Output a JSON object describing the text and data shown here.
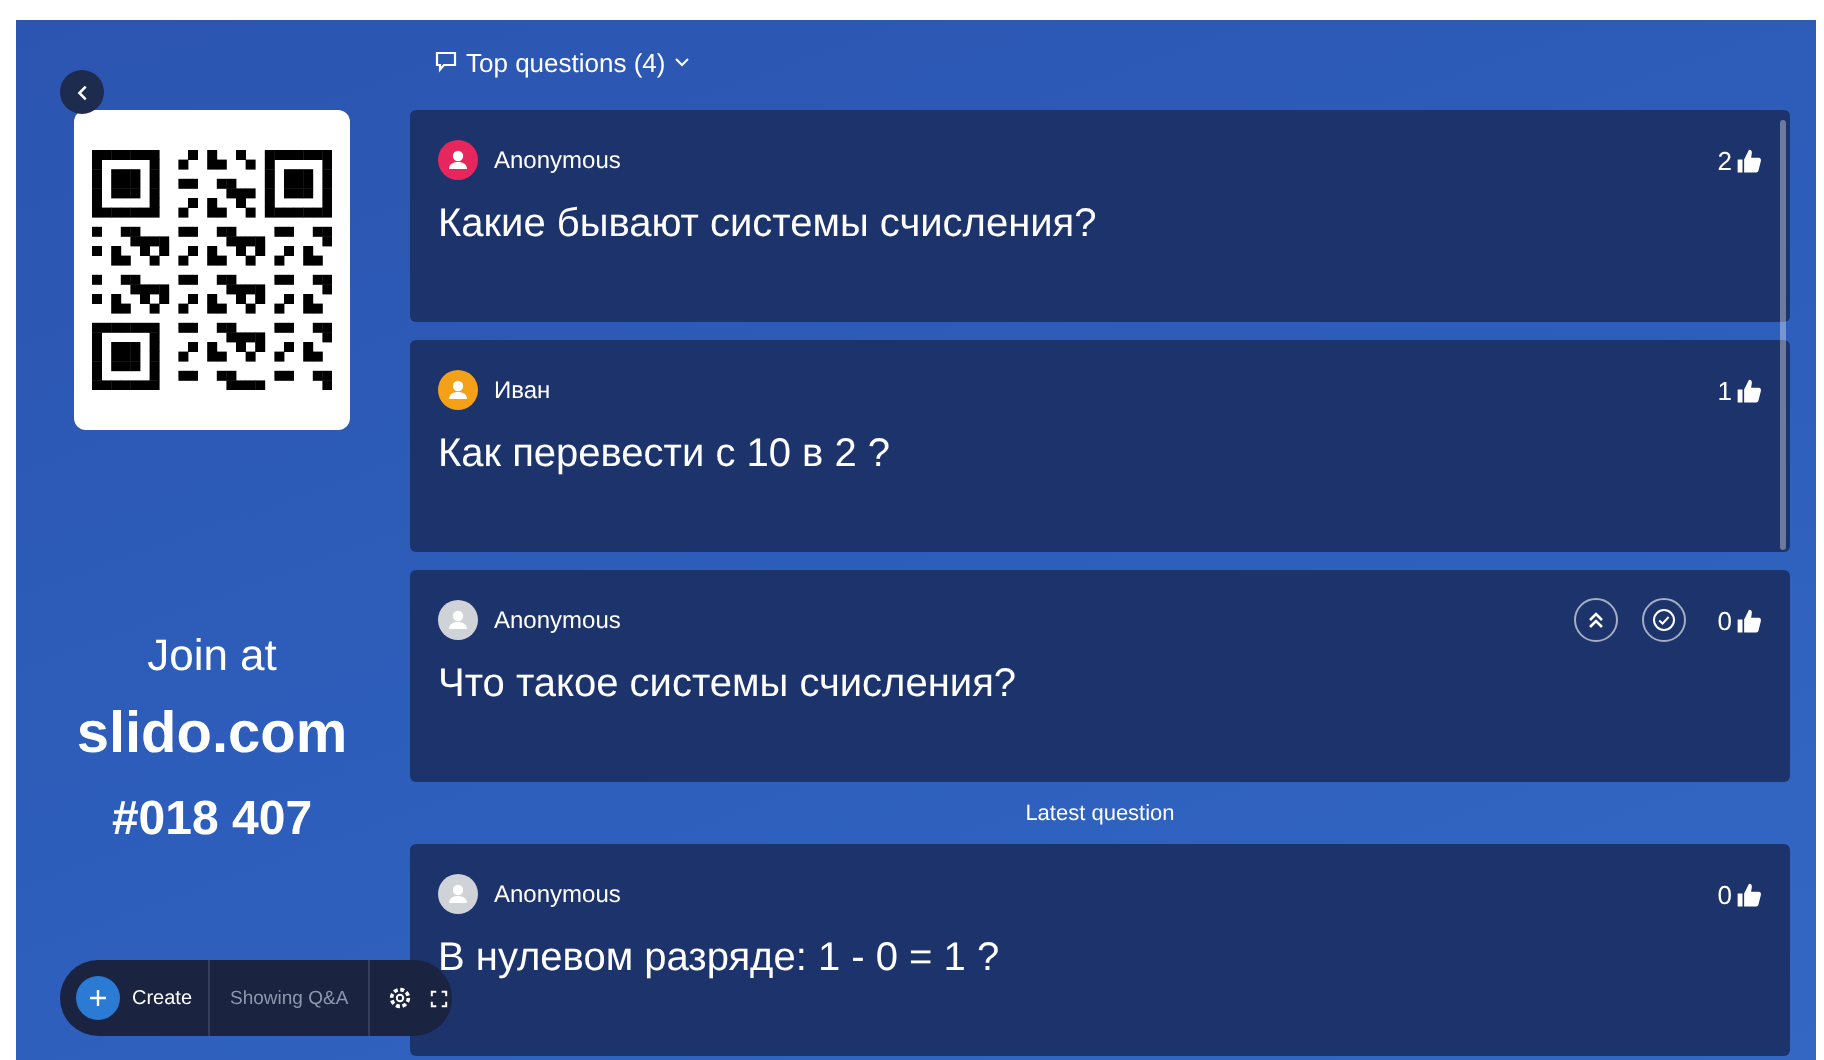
{
  "join": {
    "line1": "Join at",
    "site": "slido.com",
    "code": "#018 407"
  },
  "header": {
    "label": "Top questions (4)"
  },
  "top_questions": [
    {
      "author": "Anonymous",
      "color": "#e8265e",
      "text": "Какие бывают системы счисления?",
      "likes": "2",
      "show_actions": false
    },
    {
      "author": "Иван",
      "color": "#f5a019",
      "text": "Как перевести с 10 в 2 ?",
      "likes": "1",
      "show_actions": false
    },
    {
      "author": "Anonymous",
      "color": "#cfd3d8",
      "text": "Что такое системы счисления?",
      "likes": "0",
      "show_actions": true
    }
  ],
  "latest_label": "Latest question",
  "latest_question": {
    "author": "Anonymous",
    "color": "#cfd3d8",
    "text": "В нулевом разряде: 1 - 0 = 1 ?",
    "likes": "0",
    "show_actions": false
  },
  "toolbar": {
    "create": "Create",
    "status": "Showing Q&A"
  }
}
